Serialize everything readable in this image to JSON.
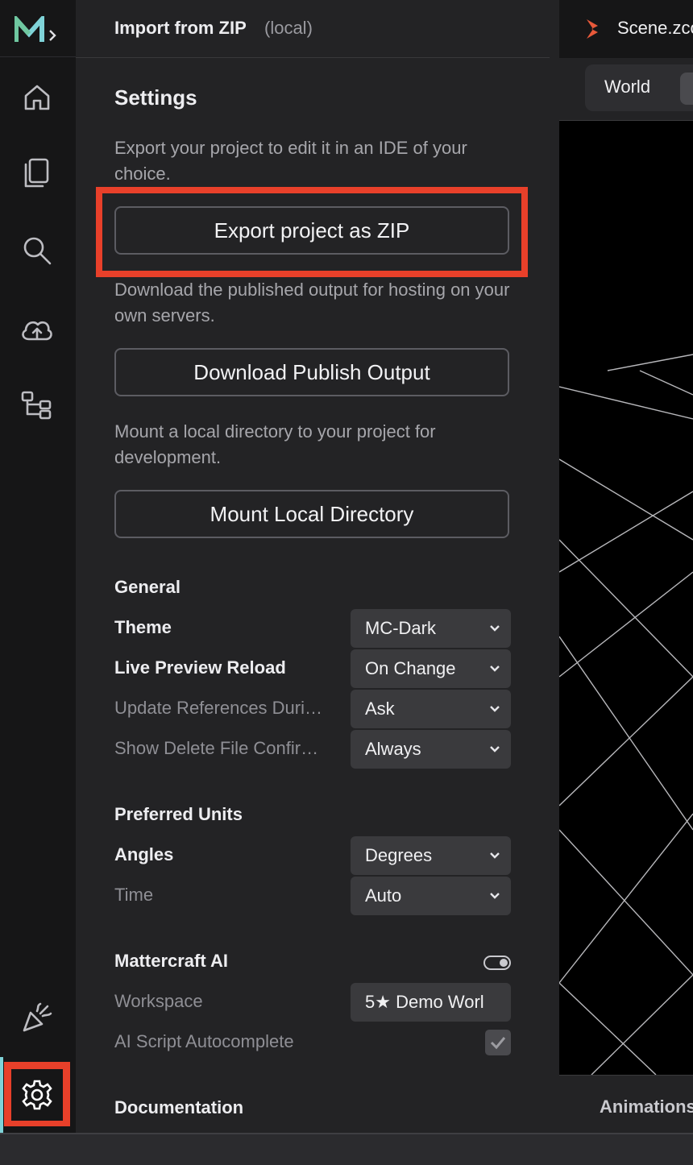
{
  "panel": {
    "header_title": "Import from ZIP",
    "header_subtitle": "(local)",
    "settings_title": "Settings",
    "export_desc": "Export your project to edit it in an IDE of your choice.",
    "export_button": "Export project as ZIP",
    "publish_desc": "Download the published output for hosting on your own servers.",
    "publish_button": "Download Publish Output",
    "mount_desc": "Mount a local directory to your project for development.",
    "mount_button": "Mount Local Directory"
  },
  "general": {
    "title": "General",
    "rows": [
      {
        "label": "Theme",
        "value": "MC-Dark"
      },
      {
        "label": "Live Preview Reload",
        "value": "On Change"
      },
      {
        "label": "Update References Duri…",
        "value": "Ask"
      },
      {
        "label": "Show Delete File Confir…",
        "value": "Always"
      }
    ]
  },
  "units": {
    "title": "Preferred Units",
    "rows": [
      {
        "label": "Angles",
        "value": "Degrees"
      },
      {
        "label": "Time",
        "value": "Auto"
      }
    ]
  },
  "ai": {
    "title": "Mattercraft AI",
    "toggle_on": true,
    "workspace_label": "Workspace",
    "workspace_value": "5★ Demo Worl",
    "autocomplete_label": "AI Script Autocomplete",
    "autocomplete_checked": true
  },
  "documentation": {
    "title": "Documentation"
  },
  "viewport": {
    "scene_tab": "Scene.zcomp",
    "world_button": "World",
    "animations_tab": "Animations"
  },
  "colors": {
    "highlight": "#e8402a",
    "accent": "#7fd3d8",
    "scene_icon": "#e8593a"
  },
  "rail_icons": [
    "home-icon",
    "files-icon",
    "search-icon",
    "cloud-upload-icon",
    "hierarchy-icon",
    "party-popper-icon",
    "gear-icon"
  ]
}
